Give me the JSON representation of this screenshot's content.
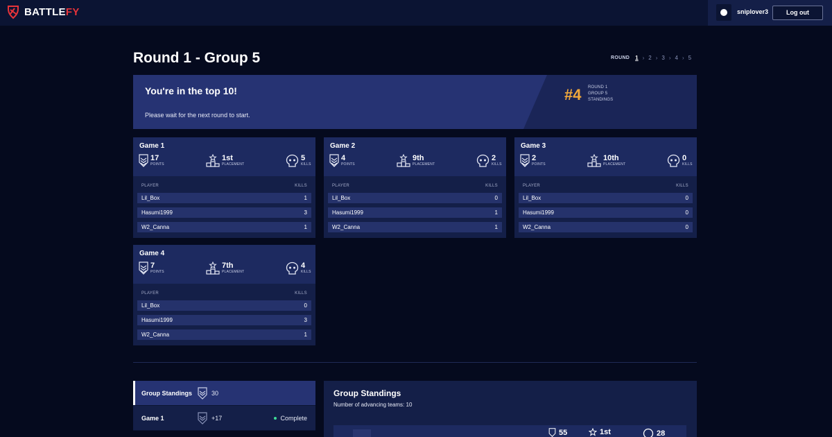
{
  "nav": {
    "brand_a": "BATTLE",
    "brand_b": "FY",
    "username": "sniplover3",
    "logout": "Log out"
  },
  "page": {
    "title": "Round 1 - Group 5",
    "round_label": "ROUND",
    "rounds": [
      "1",
      "2",
      "3",
      "4",
      "5"
    ]
  },
  "banner": {
    "title": "You're in the top 10!",
    "subtitle": "Please wait for the next round to start.",
    "rank": "#4",
    "meta": [
      "ROUND 1",
      "GROUP 5",
      "STANDINGS"
    ]
  },
  "labels": {
    "points": "POINTS",
    "placement": "PLACEMENT",
    "kills": "KILLS",
    "player_col": "PLAYER",
    "kills_col": "KILLS"
  },
  "games": [
    {
      "title": "Game 1",
      "points": "17",
      "placement": "1st",
      "kills": "5",
      "players": [
        {
          "name": "Lil_Box",
          "kills": "1"
        },
        {
          "name": "Hasumi1999",
          "kills": "3"
        },
        {
          "name": "W2_Canna",
          "kills": "1"
        }
      ]
    },
    {
      "title": "Game 2",
      "points": "4",
      "placement": "9th",
      "kills": "2",
      "players": [
        {
          "name": "Lil_Box",
          "kills": "0"
        },
        {
          "name": "Hasumi1999",
          "kills": "1"
        },
        {
          "name": "W2_Canna",
          "kills": "1"
        }
      ]
    },
    {
      "title": "Game 3",
      "points": "2",
      "placement": "10th",
      "kills": "0",
      "players": [
        {
          "name": "Lil_Box",
          "kills": "0"
        },
        {
          "name": "Hasumi1999",
          "kills": "0"
        },
        {
          "name": "W2_Canna",
          "kills": "0"
        }
      ]
    },
    {
      "title": "Game 4",
      "points": "7",
      "placement": "7th",
      "kills": "4",
      "players": [
        {
          "name": "Lil_Box",
          "kills": "0"
        },
        {
          "name": "Hasumi1999",
          "kills": "3"
        },
        {
          "name": "W2_Canna",
          "kills": "1"
        }
      ]
    }
  ],
  "standings_tabs": [
    {
      "label": "Group Standings",
      "value": "30",
      "status": ""
    },
    {
      "label": "Game 1",
      "value": "+17",
      "status": "Complete"
    }
  ],
  "standings_panel": {
    "title": "Group Standings",
    "subtitle": "Number of advancing teams: 10",
    "row_points": "55",
    "row_placement": "1st",
    "row_kills": "28"
  },
  "colors": {
    "background": "#050a1e",
    "card": "#141f48",
    "banner": "#263373",
    "rank": "#f2a93b",
    "brand_red": "#e8343a",
    "status_green": "#3ddc97"
  }
}
